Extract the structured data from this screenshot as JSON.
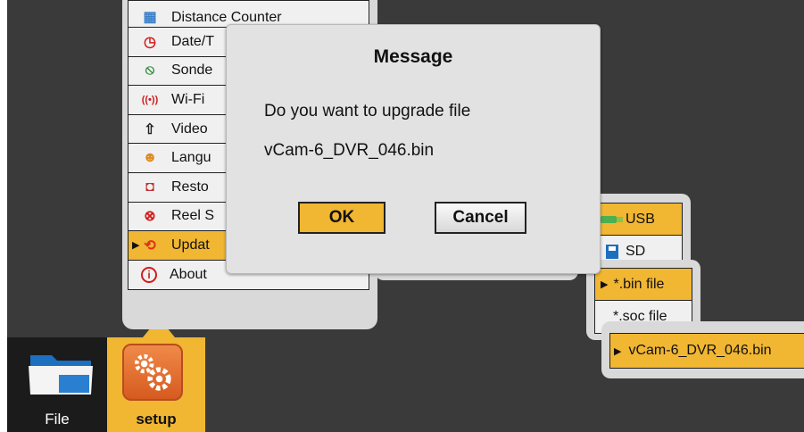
{
  "setup_menu": {
    "items": [
      {
        "label": "Distance Counter",
        "icon": "calculator-icon"
      },
      {
        "label": "Date/T",
        "icon": "clock-icon"
      },
      {
        "label": "Sonde",
        "icon": "sonde-icon"
      },
      {
        "label": "Wi-Fi",
        "icon": "wifi-icon"
      },
      {
        "label": "Video",
        "icon": "video-export-icon"
      },
      {
        "label": "Langu",
        "icon": "people-icon"
      },
      {
        "label": "Resto",
        "icon": "restore-icon"
      },
      {
        "label": "Reel S",
        "icon": "reel-icon"
      },
      {
        "label": "Updat",
        "icon": "update-icon",
        "active": true
      },
      {
        "label": "About",
        "icon": "info-icon"
      }
    ]
  },
  "storage_menu": {
    "items": [
      {
        "label": "USB",
        "icon": "usb-icon",
        "active": true
      },
      {
        "label": "SD",
        "icon": "sd-card-icon"
      }
    ]
  },
  "filetype_menu": {
    "items": [
      {
        "label": "*.bin file",
        "active": true
      },
      {
        "label": "*.soc file"
      }
    ]
  },
  "file_list": {
    "selected": "vCam-6_DVR_046.bin"
  },
  "dialog": {
    "title": "Message",
    "message": "Do you want to upgrade file",
    "filename": "vCam-6_DVR_046.bin",
    "ok_label": "OK",
    "cancel_label": "Cancel"
  },
  "taskbar": {
    "file_label": "File",
    "setup_label": "setup"
  },
  "colors": {
    "accent": "#f1b632",
    "background": "#3a3a3a",
    "panel": "#d9d9d9",
    "taskbar": "#1b1b1b"
  }
}
